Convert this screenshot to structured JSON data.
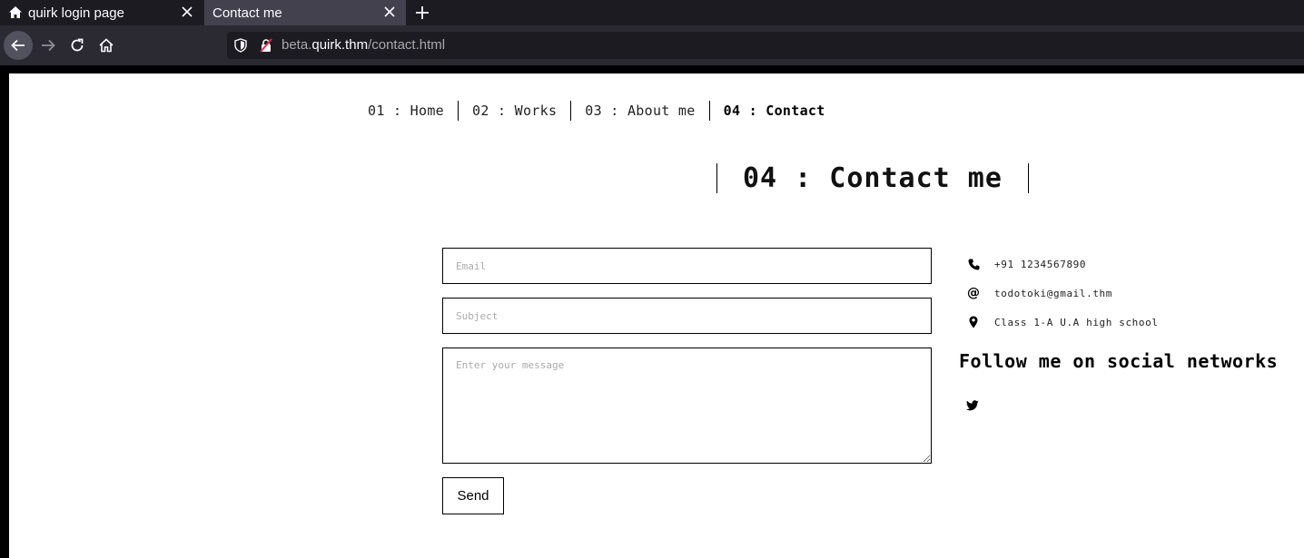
{
  "browser": {
    "tabs": [
      {
        "title": "quirk login page",
        "icon": "home-icon",
        "active": false
      },
      {
        "title": "Contact me",
        "icon": "",
        "active": true
      }
    ],
    "url": {
      "prefix": "beta.",
      "host": "quirk.thm",
      "path": "/contact.html"
    }
  },
  "nav": {
    "items": [
      {
        "label": "01 : Home",
        "active": false
      },
      {
        "label": "02 : Works",
        "active": false
      },
      {
        "label": "03 : About me",
        "active": false
      },
      {
        "label": "04 : Contact",
        "active": true
      }
    ]
  },
  "page": {
    "title": "04 : Contact me"
  },
  "form": {
    "email_placeholder": "Email",
    "subject_placeholder": "Subject",
    "message_placeholder": "Enter your message",
    "send_label": "Send"
  },
  "contact": {
    "phone": "+91 1234567890",
    "email": "todotoki@gmail.thm",
    "location": "Class 1-A U.A high school",
    "at_symbol": "@"
  },
  "social": {
    "heading": "Follow me on social networks",
    "networks": [
      "twitter-icon"
    ]
  }
}
